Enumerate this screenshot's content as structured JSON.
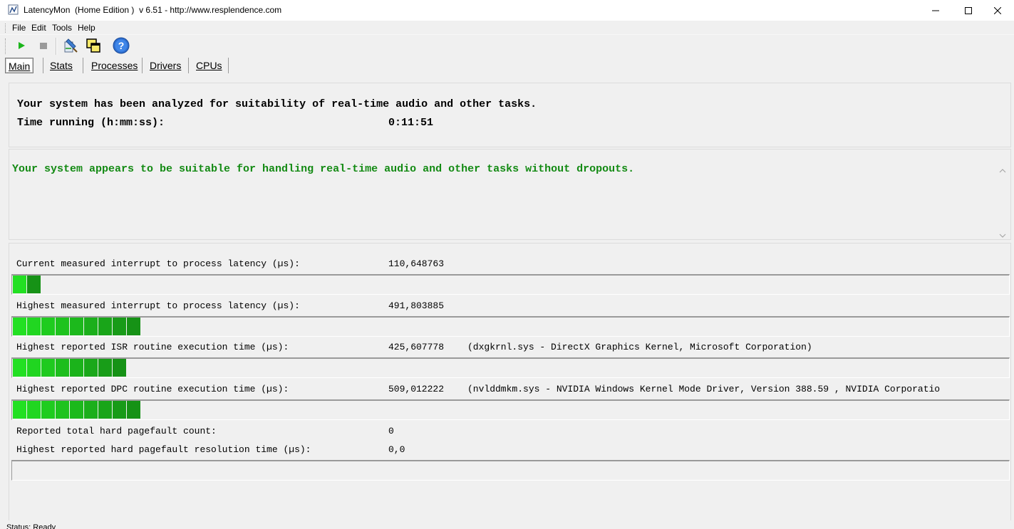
{
  "window": {
    "title": "LatencyMon  (Home Edition )  v 6.51 - http://www.resplendence.com"
  },
  "menu": [
    "File",
    "Edit",
    "Tools",
    "Help"
  ],
  "toolbar": {
    "buttons": [
      "play-icon",
      "stop-icon",
      "report-icon",
      "copy-window-icon",
      "help-icon"
    ]
  },
  "tabs": [
    "Main",
    "Stats",
    "Processes",
    "Drivers",
    "CPUs"
  ],
  "summary": {
    "analyzed": "Your system has been analyzed for suitability of real-time audio and other tasks.",
    "time_label": "Time running (h:mm:ss):",
    "time_value": "0:11:51"
  },
  "verdict": {
    "text": "Your system appears to be suitable for handling real-time audio and other tasks without dropouts.",
    "color": "#138a13"
  },
  "metrics": [
    {
      "label": "Current measured interrupt to process latency (µs):",
      "value": "110,648763",
      "detail": "",
      "bar_segments": 2
    },
    {
      "label": "Highest measured interrupt to process latency (µs):",
      "value": "491,803885",
      "detail": "",
      "bar_segments": 9
    },
    {
      "label": "Highest reported ISR routine execution time (µs):",
      "value": "425,607778",
      "detail": "(dxgkrnl.sys - DirectX Graphics Kernel, Microsoft Corporation)",
      "bar_segments": 8
    },
    {
      "label": "Highest reported DPC routine execution time (µs):",
      "value": "509,012222",
      "detail": "(nvlddmkm.sys - NVIDIA Windows Kernel Mode Driver, Version 388.59 , NVIDIA Corporatio",
      "bar_segments": 9
    },
    {
      "label": "Reported total hard pagefault count:",
      "value": "0",
      "detail": ""
    },
    {
      "label": "Highest reported hard pagefault resolution time (µs):",
      "value": "0,0",
      "detail": "",
      "bar_segments": 0
    }
  ],
  "status": {
    "text": "Status: Ready"
  },
  "colors": {
    "bar_green_bright": "#22e022",
    "bar_green_dark": "#0a9a0a"
  }
}
